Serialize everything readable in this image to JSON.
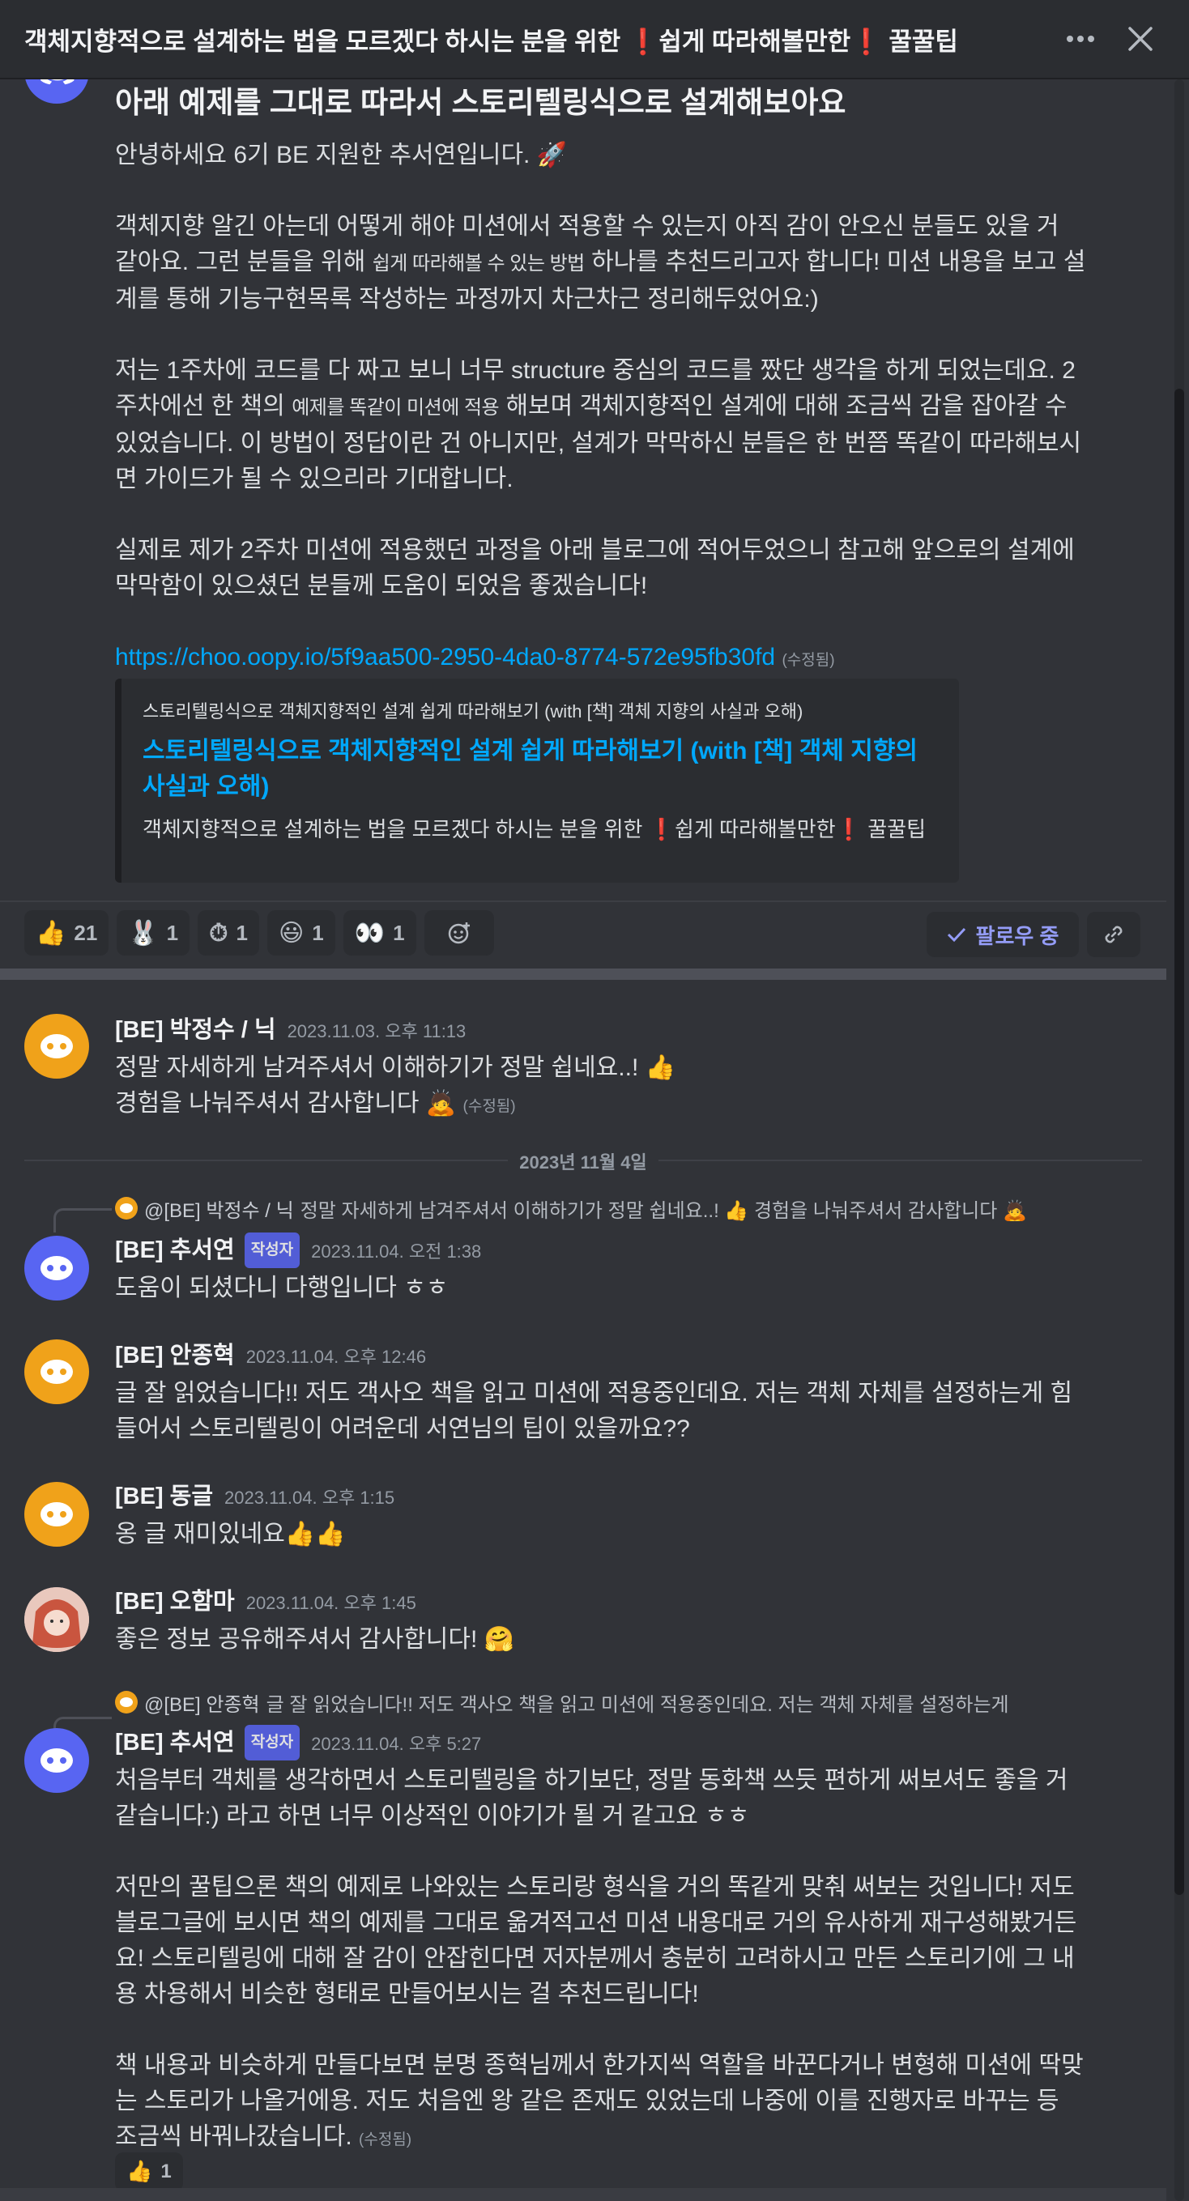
{
  "header": {
    "title_part1": "객체지향적으로 설계하는 법을 모르겠다 하시는 분을 위한 ",
    "title_part2": "쉽게 따라해볼만한",
    "title_part3": " 꿀꿀팁",
    "exclaim": "❗",
    "more_icon": "more-horizontal-icon",
    "close_icon": "close-icon"
  },
  "post": {
    "heading": "아래 예제를 그대로 따라서 스토리텔링식으로 설계해보아요",
    "greeting": "안녕하세요 6기 BE 지원한 추서연입니다. 🚀",
    "para1_a": "객체지향 알긴 아는데 어떻게 해야 미션에서 적용할 수 있는지 아직 감이 안오신 분들도 있을 거 같아요. 그런 분들을 위해 ",
    "para1_small": "쉽게 따라해볼 수 있는 방법",
    "para1_b": " 하나를 추천드리고자 합니다! 미션 내용을 보고 설계를 통해 기능구현목록 작성하는 과정까지 차근차근 정리해두었어요:)",
    "para2_a": "저는 1주차에 코드를 다 짜고 보니 너무 structure 중심의 코드를 짰단 생각을 하게 되었는데요. 2주차에선 한 책의 ",
    "para2_small": "예제를 똑같이 미션에 적용",
    "para2_b": " 해보며 객체지향적인 설계에 대해 조금씩 감을 잡아갈 수 있었습니다. 이 방법이 정답이란 건 아니지만, 설계가 막막하신 분들은 한 번쯤 똑같이 따라해보시면 가이드가 될 수 있으리라 기대합니다.",
    "para3": "실제로 제가 2주차 미션에 적용했던 과정을 아래 블로그에 적어두었으니 참고해 앞으로의 설계에 막막함이 있으셨던 분들께 도움이 되었음 좋겠습니다!",
    "link": "https://choo.oopy.io/5f9aa500-2950-4da0-8774-572e95fb30fd",
    "edited": "(수정됨)",
    "embed": {
      "provider": "스토리텔링식으로 객체지향적인 설계 쉽게 따라해보기 (with [책] 객체 지향의 사실과 오해)",
      "title": "스토리텔링식으로 객체지향적인 설계 쉽게 따라해보기 (with [책] 객체 지향의 사실과 오해)",
      "desc_a": "객체지향적으로 설계하는 법을 모르겠다 하시는 분을 위한 ",
      "desc_b": "쉽게 따라해볼만한",
      "desc_c": " 꿀꿀팁"
    }
  },
  "reactions": [
    {
      "emoji": "👍",
      "count": "21"
    },
    {
      "emoji": "🐰",
      "count": "1"
    },
    {
      "emoji": "⏱",
      "count": "1"
    },
    {
      "emoji": "😃",
      "count": "1"
    },
    {
      "emoji": "👀",
      "count": "1"
    }
  ],
  "add_reaction_icon": "add-reaction-icon",
  "follow_label": "팔로우 중",
  "copy_link_icon": "link-icon",
  "date_separator": "2023년 11월 4일",
  "messages": {
    "m1": {
      "author": "[BE] 박정수 / 닉",
      "time": "2023.11.03. 오후 11:13",
      "line1": "정말 자세하게 남겨주셔서 이해하기가 정말 쉽네요..! 👍",
      "line2": "경험을 나눠주셔서 감사합니다 🙇",
      "edited": "(수정됨)"
    },
    "m2": {
      "reply_to": "@[BE] 박정수 / 닉",
      "reply_text": " 정말 자세하게 남겨주셔서 이해하기가 정말 쉽네요..! 👍 경험을 나눠주셔서 감사합니다 🙇",
      "author": "[BE] 추서연",
      "badge": "작성자",
      "time": "2023.11.04. 오전 1:38",
      "text": "도움이 되셨다니 다행입니다 ㅎㅎ"
    },
    "m3": {
      "author": "[BE] 안종혁",
      "time": "2023.11.04. 오후 12:46",
      "text": "글 잘 읽었습니다!! 저도 객사오 책을 읽고 미션에 적용중인데요. 저는 객체 자체를 설정하는게 힘들어서 스토리텔링이 어려운데 서연님의 팁이 있을까요??"
    },
    "m4": {
      "author": "[BE] 동글",
      "time": "2023.11.04. 오후 1:15",
      "text": "옹 글 재미있네요👍👍"
    },
    "m5": {
      "author": "[BE] 오함마",
      "time": "2023.11.04. 오후 1:45",
      "text": "좋은 정보 공유해주셔서 감사합니다! 🤗"
    },
    "m6": {
      "reply_to": "@[BE] 안종혁",
      "reply_text": " 글 잘 읽었습니다!! 저도 객사오 책을 읽고 미션에 적용중인데요. 저는 객체 자체를 설정하는게",
      "author": "[BE] 추서연",
      "badge": "작성자",
      "time": "2023.11.04. 오후 5:27",
      "p1": "처음부터 객체를 생각하면서 스토리텔링을 하기보단, 정말 동화책 쓰듯 편하게 써보셔도 좋을 거 같습니다:) 라고 하면 너무 이상적인 이야기가 될 거 같고요 ㅎㅎ",
      "p2": "저만의 꿀팁으론 책의 예제로 나와있는 스토리랑 형식을 거의 똑같게 맞춰 써보는 것입니다! 저도 블로그글에 보시면 책의 예제를 그대로 옮겨적고선 미션 내용대로 거의 유사하게 재구성해봤거든요! 스토리텔링에 대해 잘 감이 안잡힌다면 저자분께서 충분히 고려하시고 만든 스토리기에 그 내용 차용해서 비슷한 형태로 만들어보시는 걸 추천드립니다!",
      "p3": "책 내용과 비슷하게 만들다보면 분명 종혁님께서 한가지씩 역할을 바꾼다거나 변형해 미션에 딱맞는 스토리가 나올거에용. 저도 처음엔 왕 같은 존재도 있었는데 나중에 이를 진행자로 바꾸는 등 조금씩 바꿔나갔습니다.",
      "edited": "(수정됨)",
      "reaction": {
        "emoji": "👍",
        "count": "1"
      }
    }
  },
  "colors": {
    "background": "#313338",
    "accent": "#5865f2",
    "link": "#00a8fc",
    "discord_orange": "#f0a21a"
  }
}
